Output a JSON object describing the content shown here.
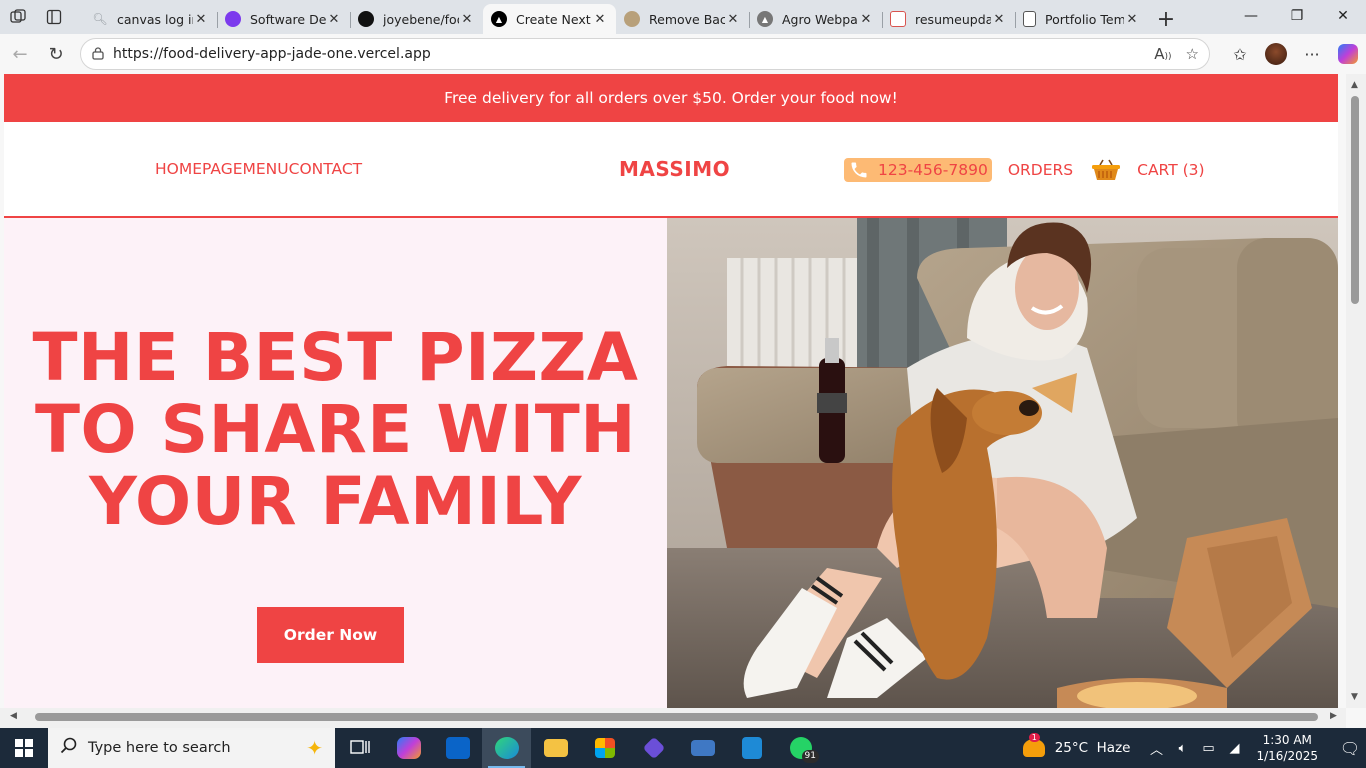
{
  "browser": {
    "tabs": [
      {
        "title": "canvas log in",
        "icon": "search-icon",
        "color": "#9aa0a6",
        "active": false
      },
      {
        "title": "Software Dev",
        "icon": "site-favicon",
        "color": "#7c3aed",
        "active": false
      },
      {
        "title": "joyebene/foo",
        "icon": "github-icon",
        "color": "#111111",
        "active": false
      },
      {
        "title": "Create Next A",
        "icon": "vercel-icon",
        "color": "#000000",
        "active": true
      },
      {
        "title": "Remove Back",
        "icon": "site-favicon",
        "color": "#b8a07a",
        "active": false
      },
      {
        "title": "Agro Webpag",
        "icon": "vercel-icon",
        "color": "#777777",
        "active": false
      },
      {
        "title": "resumeupdat",
        "icon": "pdf-icon",
        "color": "#d9544f",
        "active": false
      },
      {
        "title": "Portfolio Tem",
        "icon": "document-icon",
        "color": "#555555",
        "active": false
      }
    ],
    "url": "https://food-delivery-app-jade-one.vercel.app"
  },
  "page": {
    "promo_text": "Free delivery for all orders over $50. Order your food now!",
    "nav": {
      "links": [
        "HOMEPAGE",
        "MENU",
        "CONTACT"
      ],
      "logo": "MASSIMO",
      "phone": "123-456-7890",
      "orders": "ORDERS",
      "cart": "CART (3)"
    },
    "hero": {
      "title_lines": [
        "THE BEST PIZZA",
        "TO SHARE WITH",
        "YOUR FAMILY"
      ],
      "cta": "Order Now"
    },
    "colors": {
      "accent": "#ef4444",
      "phone_pill": "#fdba74",
      "hero_bg": "#fdf2f8"
    }
  },
  "taskbar": {
    "search_placeholder": "Type here to search",
    "whatsapp_badge": "91",
    "weather_badge": "1",
    "weather": "25°C  Haze",
    "time": "1:30 AM",
    "date": "1/16/2025"
  }
}
